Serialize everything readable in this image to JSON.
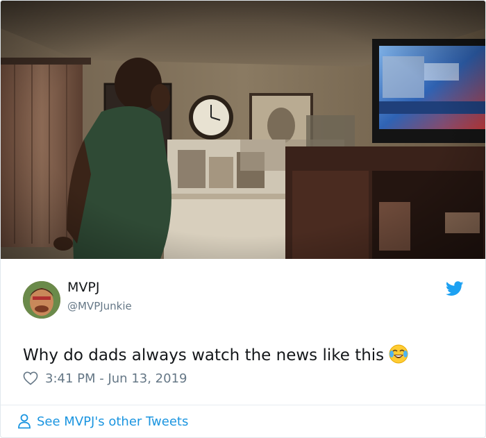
{
  "tweet": {
    "author_name": "MVPJ",
    "author_handle": "@MVPJunkie",
    "text": "Why do dads always watch the news like this",
    "emoji": "face-with-tears-of-joy",
    "timestamp": "3:41 PM - Jun 13, 2019",
    "see_more_label": "See MVPJ's other Tweets"
  },
  "photo": {
    "description_icon": "photo-of-man-watching-tv"
  },
  "colors": {
    "link": "#1b95e0",
    "secondary_text": "#657786",
    "primary_text": "#14171a",
    "twitter_blue": "#1da1f2"
  }
}
